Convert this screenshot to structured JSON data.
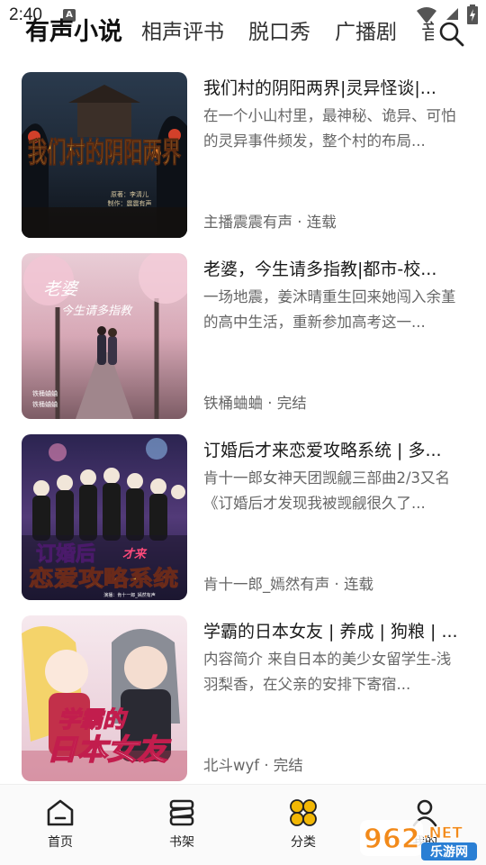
{
  "status_bar": {
    "time": "2:40",
    "notification_letter": "A"
  },
  "tabs": [
    {
      "label": "有声小说",
      "active": true
    },
    {
      "label": "相声评书",
      "active": false
    },
    {
      "label": "脱口秀",
      "active": false
    },
    {
      "label": "广播剧",
      "active": false
    },
    {
      "label": "音",
      "active": false
    }
  ],
  "books": [
    {
      "title": "我们村的阴阳两界|灵异怪谈|...",
      "description": "在一个小山村里，最神秘、诡异、可怕的灵异事件频发，整个村的布局...",
      "meta": "主播震震有声 · 连载",
      "cover_title": "我们村的阴阳两界",
      "cover_sub1": "原著：李清儿",
      "cover_sub2": "制作：震震有声"
    },
    {
      "title": "老婆，今生请多指教|都市-校...",
      "description": "一场地震，姜沐晴重生回来她闯入余堇的高中生活，重新参加高考这一...",
      "meta": "铁桶蛐蛐 · 完结",
      "cover_title_1": "老婆",
      "cover_title_2": "今生请多指教",
      "cover_credit_1": "铁桶蛐蛐",
      "cover_credit_2": "铁桶蛐蛐"
    },
    {
      "title": "订婚后才来恋爱攻略系统 | 多...",
      "description": "肯十一郎女神天团觊觎三部曲2/3又名《订婚后才发现我被觊觎很久了...",
      "meta": "肯十一郎_嫣然有声 · 连载",
      "cover_title_1": "订婚后",
      "cover_title_tag": "才来",
      "cover_title_2": "恋爱攻略系统",
      "cover_credit": "演播：肯十一郎_嫣然有声"
    },
    {
      "title": "学霸的日本女友 | 养成 | 狗粮 | ...",
      "description": "内容简介 来自日本的美少女留学生-浅羽梨香，在父亲的安排下寄宿...",
      "meta": "北斗wyf · 完结",
      "cover_title_1": "学霸的",
      "cover_title_2": "日本女友"
    }
  ],
  "bottom_nav": [
    {
      "label": "首页",
      "icon": "home-icon"
    },
    {
      "label": "书架",
      "icon": "bookshelf-icon"
    },
    {
      "label": "分类",
      "icon": "category-icon",
      "active": true
    },
    {
      "label": "我的",
      "icon": "profile-icon"
    }
  ],
  "watermark": {
    "number": "962",
    "tld": ".NET",
    "site": "乐游网"
  },
  "colors": {
    "category_active": "#f2b705",
    "text_primary": "#1a1a1a",
    "text_secondary": "#666666"
  }
}
